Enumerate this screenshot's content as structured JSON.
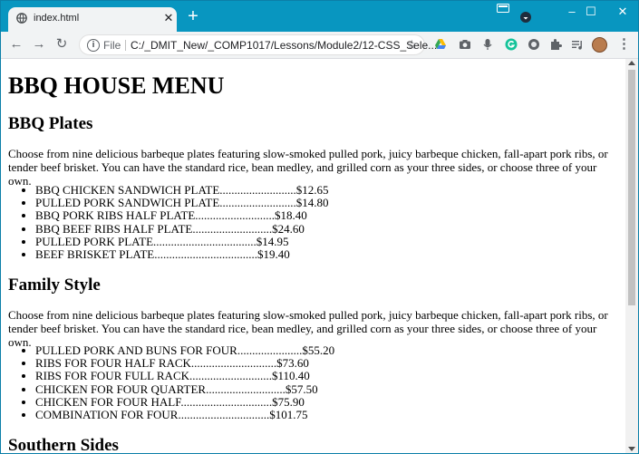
{
  "browser": {
    "tab_title": "index.html",
    "tab_close": "✕",
    "new_tab": "+",
    "address": {
      "scheme_label": "File",
      "url": "C:/_DMIT_New/_COMP1017/Lessons/Module2/12-CSS_Sele..."
    },
    "window_controls": {
      "minimize": "–",
      "maximize": "☐",
      "close": "✕"
    },
    "nav": {
      "back": "←",
      "forward": "→",
      "reload": "↻"
    },
    "menu": "⋮",
    "colors": {
      "tabstrip": "#0896c0",
      "toolbar": "#f1f3f4"
    },
    "extension_icons": [
      "google-drive-icon",
      "camera-icon",
      "microphone-icon",
      "grammarly-icon",
      "circle-extension-icon",
      "puzzle-extensions-icon",
      "media-queue-icon"
    ]
  },
  "page": {
    "title": "BBQ HOUSE MENU",
    "sections": [
      {
        "heading": "BBQ Plates",
        "description": "Choose from nine delicious barbeque plates featuring slow-smoked pulled pork, juicy barbeque chicken, fall-apart pork ribs, or tender beef brisket. You can have the standard rice, bean medley, and grilled corn as your three sides, or choose three of your own.",
        "items": [
          "BBQ CHICKEN SANDWICH PLATE..........................$12.65",
          "PULLED PORK SANDWICH PLATE..........................$14.80",
          "BBQ PORK RIBS HALF PLATE...........................$18.40",
          "BBQ BEEF RIBS HALF PLATE...........................$24.60",
          "PULLED PORK PLATE...................................$14.95",
          "BEEF BRISKET PLATE...................................$19.40"
        ]
      },
      {
        "heading": "Family Style",
        "description": "Choose from nine delicious barbeque plates featuring slow-smoked pulled pork, juicy barbeque chicken, fall-apart pork ribs, or tender beef brisket. You can have the standard rice, bean medley, and grilled corn as your three sides, or choose three of your own.",
        "items": [
          "PULLED PORK AND BUNS FOR FOUR......................$55.20",
          "RIBS FOR FOUR HALF RACK.............................$73.60",
          "RIBS FOR FOUR FULL RACK............................$110.40",
          "CHICKEN FOR FOUR QUARTER...........................$57.50",
          "CHICKEN FOR FOUR HALF...............................$75.90",
          "COMBINATION FOR FOUR...............................$101.75"
        ]
      },
      {
        "heading": "Southern Sides"
      }
    ]
  }
}
